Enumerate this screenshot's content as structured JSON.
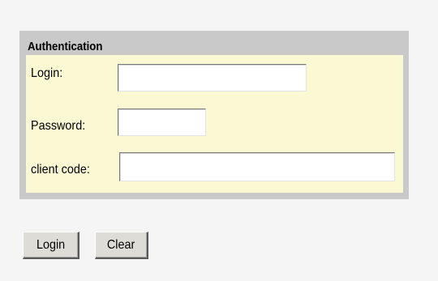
{
  "form": {
    "legend": "Authentication",
    "fields": {
      "login": {
        "label": "Login:",
        "value": ""
      },
      "password": {
        "label": "Password:",
        "value": ""
      },
      "client_code": {
        "label": "client code:",
        "value": ""
      }
    }
  },
  "buttons": {
    "login_label": "Login",
    "clear_label": "Clear"
  },
  "colors": {
    "page_background": "#f5f5f5",
    "fieldset_border": "#c9c9c9",
    "panel_background": "#fbf9d4"
  }
}
